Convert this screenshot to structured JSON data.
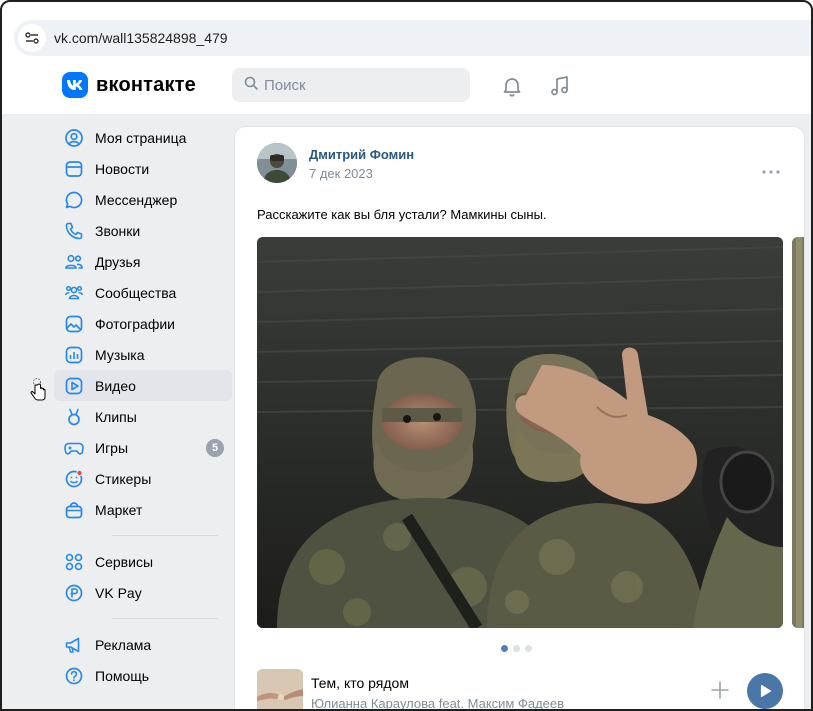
{
  "browser": {
    "url": "vk.com/wall135824898_479",
    "site_icon": "site-settings-icon"
  },
  "header": {
    "logo_mark": "vk-logo-icon",
    "logo_text": "вконтакте",
    "search_placeholder": "Поиск",
    "icons": [
      "bell-icon",
      "music-note-icon"
    ]
  },
  "sidebar": {
    "items": [
      {
        "label": "Моя страница",
        "icon": "profile-icon"
      },
      {
        "label": "Новости",
        "icon": "news-icon"
      },
      {
        "label": "Мессенджер",
        "icon": "messenger-icon"
      },
      {
        "label": "Звонки",
        "icon": "phone-icon"
      },
      {
        "label": "Друзья",
        "icon": "friends-icon"
      },
      {
        "label": "Сообщества",
        "icon": "communities-icon"
      },
      {
        "label": "Фотографии",
        "icon": "photos-icon"
      },
      {
        "label": "Музыка",
        "icon": "music-icon"
      },
      {
        "label": "Видео",
        "icon": "video-icon",
        "active": true
      },
      {
        "label": "Клипы",
        "icon": "clips-icon"
      },
      {
        "label": "Игры",
        "icon": "games-icon",
        "badge": "5"
      },
      {
        "label": "Стикеры",
        "icon": "stickers-icon"
      },
      {
        "label": "Маркет",
        "icon": "market-icon"
      }
    ],
    "group2": [
      {
        "label": "Сервисы",
        "icon": "services-icon"
      },
      {
        "label": "VK Pay",
        "icon": "vkpay-icon"
      }
    ],
    "group3": [
      {
        "label": "Реклама",
        "icon": "ads-icon"
      },
      {
        "label": "Помощь",
        "icon": "help-icon"
      }
    ]
  },
  "post": {
    "author": "Дмитрий Фомин",
    "date": "7 дек 2023",
    "text": "Расскажите как вы бля устали? Мамкины сыны.",
    "gallery": {
      "total": 3,
      "current": 1
    }
  },
  "track": {
    "title": "Тем, кто рядом",
    "artist": "Юлианна Караулова feat. Максим Фадеев"
  },
  "colors": {
    "accent": "#0077ff",
    "link": "#2a5885",
    "play": "#4a76a8",
    "background": "#edeef0"
  }
}
